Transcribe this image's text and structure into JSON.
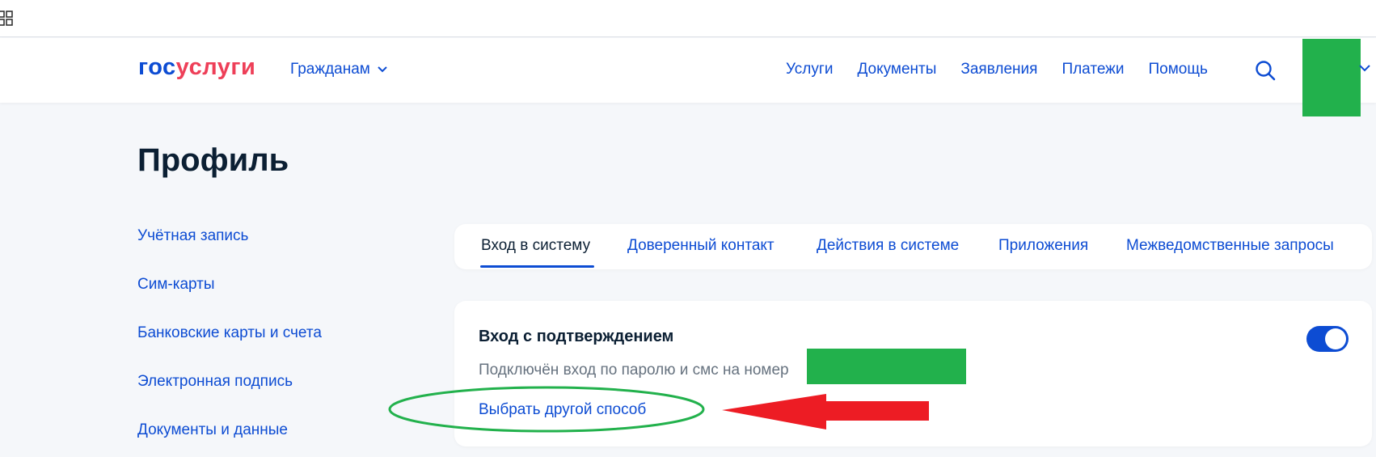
{
  "header": {
    "logo": {
      "part1": "гос",
      "part2": "услуги"
    },
    "audience_menu": {
      "label": "Гражданам"
    },
    "nav": [
      {
        "label": "Услуги"
      },
      {
        "label": "Документы"
      },
      {
        "label": "Заявления"
      },
      {
        "label": "Платежи"
      },
      {
        "label": "Помощь"
      }
    ],
    "icons": {
      "search": "search-icon",
      "apps": "grid-icon"
    }
  },
  "page": {
    "title": "Профиль"
  },
  "sidebar": {
    "items": [
      {
        "label": "Учётная запись"
      },
      {
        "label": "Сим-карты"
      },
      {
        "label": "Банковские карты и счета"
      },
      {
        "label": "Электронная подпись"
      },
      {
        "label": "Документы и данные"
      }
    ]
  },
  "tabs": [
    {
      "label": "Вход в систему",
      "active": true
    },
    {
      "label": "Доверенный контакт"
    },
    {
      "label": "Действия в системе"
    },
    {
      "label": "Приложения"
    },
    {
      "label": "Межведомственные запросы"
    }
  ],
  "login_card": {
    "title": "Вход с подтверждением",
    "description": "Подключён вход по паролю и смс на номер",
    "change_link": "Выбрать другой способ",
    "toggle_on": true
  },
  "colors": {
    "brand_blue": "#0d4cd3",
    "brand_red": "#ee3f58",
    "redaction_green": "#22b14c",
    "annotation_red": "#ed1c24",
    "annotation_green": "#22b14c"
  }
}
